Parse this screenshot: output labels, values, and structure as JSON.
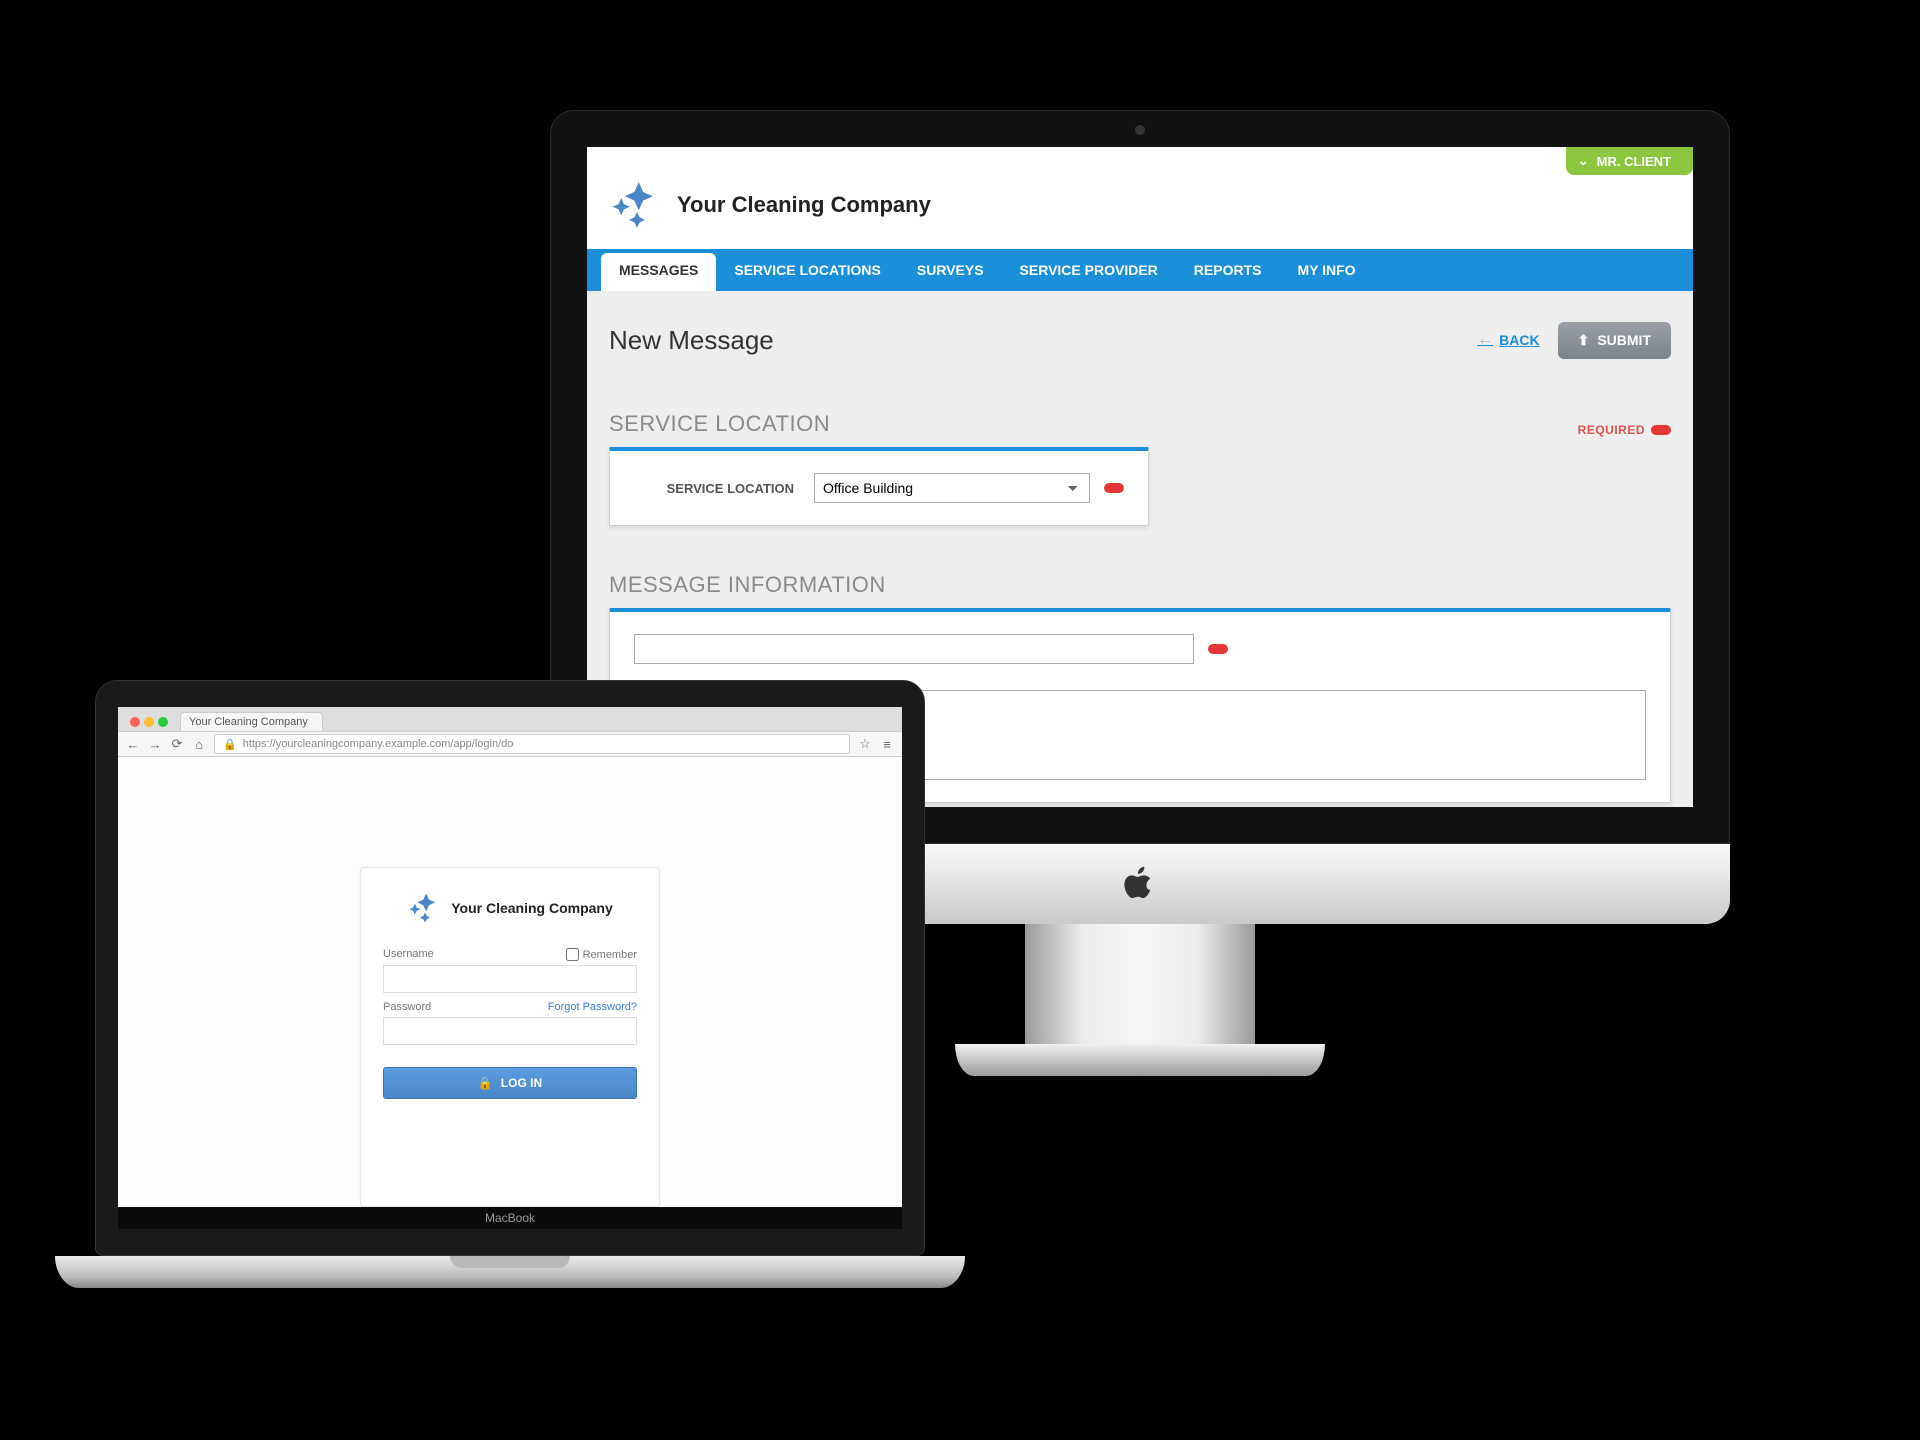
{
  "brand": {
    "name": "Your Cleaning Company"
  },
  "user": {
    "name": "MR. CLIENT"
  },
  "nav": {
    "items": [
      {
        "label": "MESSAGES",
        "active": true
      },
      {
        "label": "SERVICE LOCATIONS",
        "active": false
      },
      {
        "label": "SURVEYS",
        "active": false
      },
      {
        "label": "SERVICE PROVIDER",
        "active": false
      },
      {
        "label": "REPORTS",
        "active": false
      },
      {
        "label": "MY INFO",
        "active": false
      }
    ]
  },
  "page": {
    "title": "New Message",
    "back": "BACK",
    "submit": "SUBMIT"
  },
  "section_location": {
    "heading": "SERVICE LOCATION",
    "required": "REQUIRED",
    "field_label": "SERVICE LOCATION",
    "value": "Office Building"
  },
  "section_message": {
    "heading": "MESSAGE INFORMATION"
  },
  "laptop": {
    "tab_title": "Your Cleaning Company",
    "url": "https://yourcleaningcompany.example.com/app/login/do",
    "device_label": "MacBook"
  },
  "login": {
    "brand": "Your Cleaning Company",
    "username_label": "Username",
    "remember_label": "Remember",
    "password_label": "Password",
    "forgot_label": "Forgot Password?",
    "button": "LOG IN"
  }
}
